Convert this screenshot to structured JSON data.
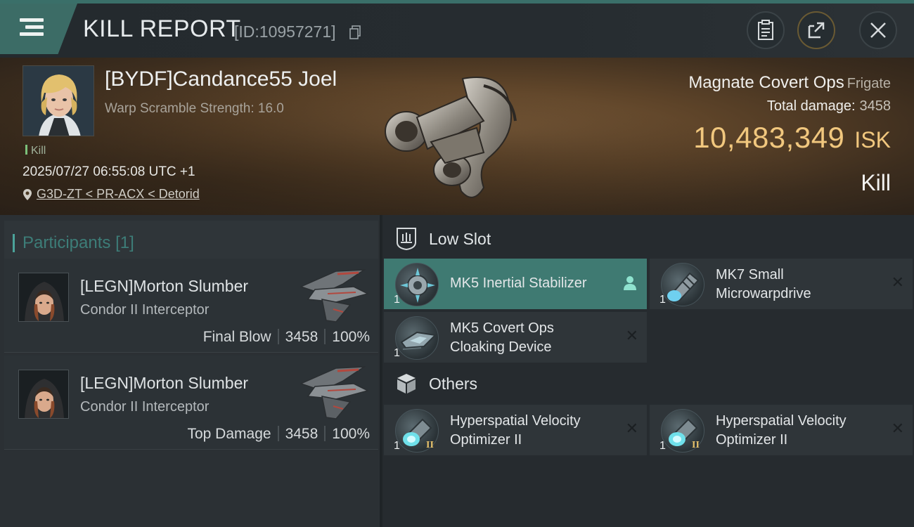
{
  "header": {
    "title": "KILL REPORT",
    "report_id": "[ID:10957271]",
    "icons": [
      "menu-icon",
      "copy-icon",
      "clipboard-icon",
      "share-icon",
      "close-icon"
    ]
  },
  "victim": {
    "name": "[BYDF]Candance55 Joel",
    "warp_scramble": "Warp Scramble Strength: 16.0",
    "kill_tag": "Kill",
    "datetime": "2025/07/27 06:55:08 UTC +1",
    "location": "G3D-ZT < PR-ACX < Detorid",
    "ship_name": "Magnate Covert Ops",
    "ship_class": "Frigate",
    "total_damage_label": "Total damage:",
    "total_damage": "3458",
    "isk_value": "10,483,349",
    "isk_unit": "ISK",
    "result": "Kill"
  },
  "participants": {
    "title": "Participants",
    "count": "[1]",
    "rows": [
      {
        "name": "[LEGN]Morton Slumber",
        "ship": "Condor II Interceptor",
        "role": "Final Blow",
        "damage": "3458",
        "percent": "100%"
      },
      {
        "name": "[LEGN]Morton Slumber",
        "ship": "Condor II Interceptor",
        "role": "Top Damage",
        "damage": "3458",
        "percent": "100%"
      }
    ]
  },
  "fitting": {
    "low_slot_label": "Low Slot",
    "others_label": "Others",
    "low_slot": [
      {
        "name": "MK5 Inertial Stabilizer",
        "qty": "1"
      },
      {
        "name_line1": "MK7 Small",
        "name_line2": "Microwarpdrive",
        "qty": "1"
      },
      {
        "name_line1": "MK5 Covert Ops",
        "name_line2": "Cloaking Device",
        "qty": "1"
      }
    ],
    "others": [
      {
        "name_line1": "Hyperspatial Velocity",
        "name_line2": "Optimizer II",
        "qty": "1",
        "tier": "II"
      },
      {
        "name_line1": "Hyperspatial Velocity",
        "name_line2": "Optimizer II",
        "qty": "1",
        "tier": "II"
      }
    ],
    "status_symbol": "✕"
  },
  "colors": {
    "accent": "#3c6c66",
    "isk": "#f1c77e",
    "active_module": "#3f7a72"
  }
}
